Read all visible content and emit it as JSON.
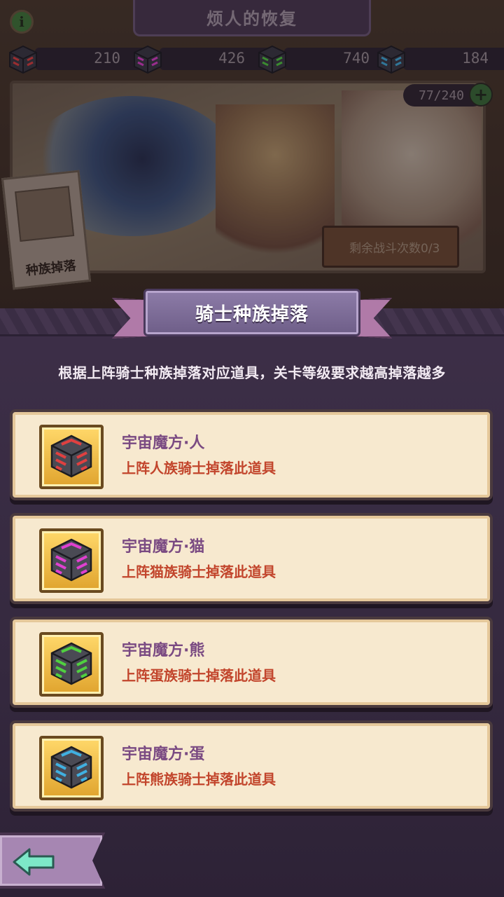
{
  "header": {
    "title": "烦人的恢复",
    "info_icon": "i"
  },
  "resources": [
    {
      "name": "cube-human",
      "value": "210",
      "color": "#e04040"
    },
    {
      "name": "cube-cat",
      "value": "426",
      "color": "#e040d0"
    },
    {
      "name": "cube-bear",
      "value": "740",
      "color": "#50d040"
    },
    {
      "name": "cube-egg",
      "value": "184",
      "color": "#40b0e0"
    }
  ],
  "scene": {
    "stamina": "77/240",
    "plus": "+",
    "battles_left": "剩余战斗次数0/3",
    "poster_label": "种族掉落"
  },
  "panel": {
    "title": "骑士种族掉落",
    "description": "根据上阵骑士种族掉落对应道具，关卡等级要求越高掉落越多",
    "items": [
      {
        "title": "宇宙魔方·人",
        "subtitle": "上阵人族骑士掉落此道具",
        "color": "#e04040"
      },
      {
        "title": "宇宙魔方·猫",
        "subtitle": "上阵猫族骑士掉落此道具",
        "color": "#e040d0"
      },
      {
        "title": "宇宙魔方·熊",
        "subtitle": "上阵蛋族骑士掉落此道具",
        "color": "#50d040"
      },
      {
        "title": "宇宙魔方·蛋",
        "subtitle": "上阵熊族骑士掉落此道具",
        "color": "#40b0e0"
      }
    ]
  }
}
